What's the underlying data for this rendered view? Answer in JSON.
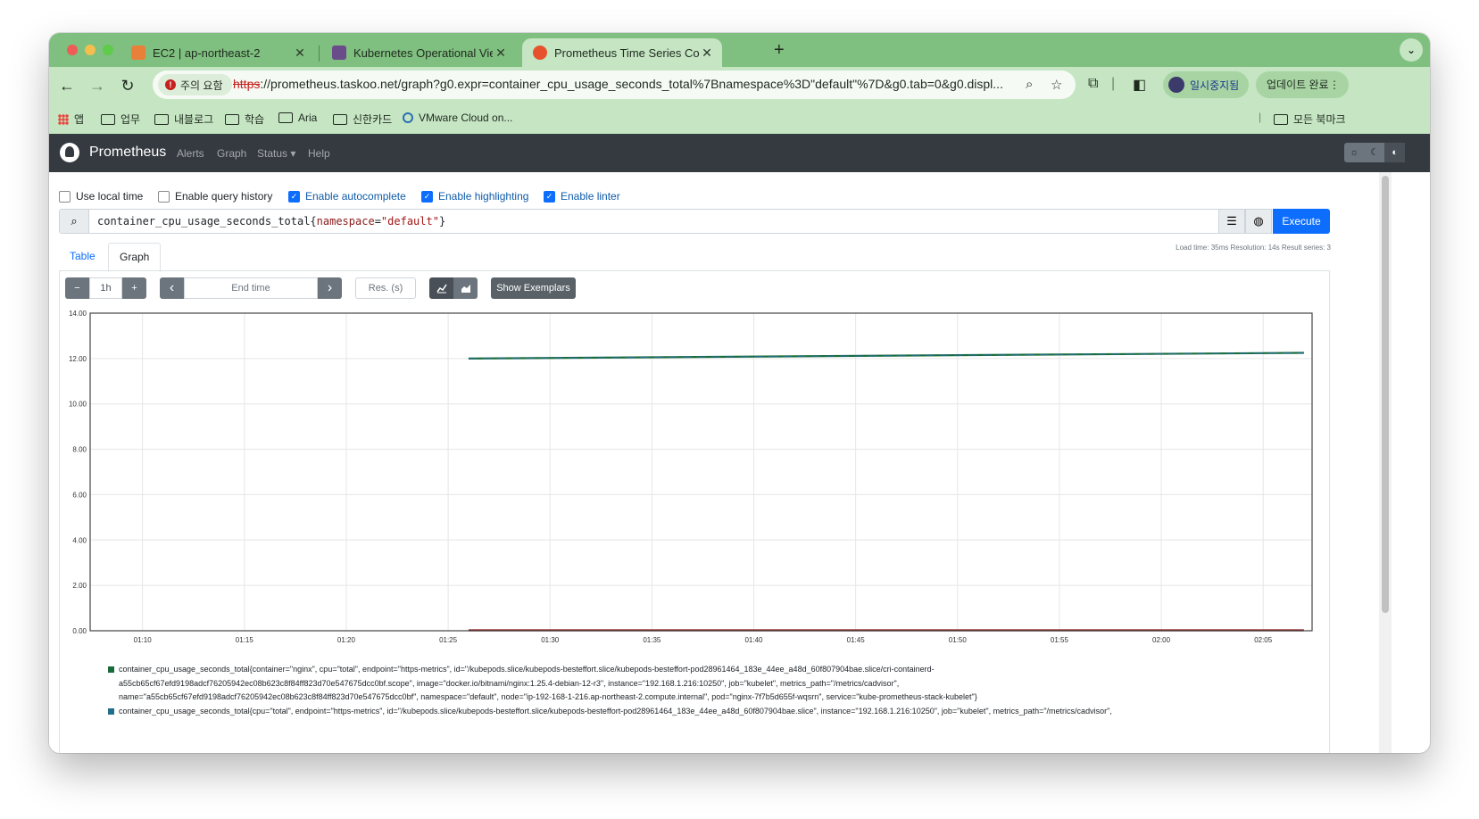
{
  "browser": {
    "tabs": [
      {
        "title": "EC2 | ap-northeast-2",
        "color": "#e8803a"
      },
      {
        "title": "Kubernetes Operational View",
        "color": "#6a4c8a"
      },
      {
        "title": "Prometheus Time Series Colle",
        "color": "#e6522c"
      }
    ],
    "security_chip": "주의 요함",
    "url_scheme": "https",
    "url_rest": "://prometheus.taskoo.net/graph?g0.expr=container_cpu_usage_seconds_total%7Bnamespace%3D\"default\"%7D&g0.tab=0&g0.displ...",
    "profile_label": "일시중지됨",
    "update_label": "업데이트 완료",
    "bookmarks": [
      "앱",
      "업무",
      "내블로그",
      "학습",
      "Aria",
      "신한카드",
      "VMware Cloud on..."
    ],
    "all_bookmarks": "모든 북마크"
  },
  "prometheus": {
    "brand": "Prometheus",
    "menu": [
      "Alerts",
      "Graph",
      "Status ▾",
      "Help"
    ],
    "options": [
      {
        "label": "Use local time",
        "checked": false
      },
      {
        "label": "Enable query history",
        "checked": false
      },
      {
        "label": "Enable autocomplete",
        "checked": true
      },
      {
        "label": "Enable highlighting",
        "checked": true
      },
      {
        "label": "Enable linter",
        "checked": true
      }
    ],
    "query": {
      "metric": "container_cpu_usage_seconds_total",
      "open": "{",
      "label_name": "namespace",
      "eq": "=",
      "label_value": "\"default\"",
      "close": "}"
    },
    "execute_label": "Execute",
    "stats": "Load time: 35ms   Resolution: 14s   Result series: 3",
    "tabs": [
      "Table",
      "Graph"
    ],
    "controls": {
      "minus": "−",
      "range": "1h",
      "plus": "+",
      "prev": "‹",
      "end_time_placeholder": "End time",
      "next": "›",
      "res_placeholder": "Res. (s)",
      "show_exemplars": "Show Exemplars"
    }
  },
  "chart_data": {
    "type": "line",
    "y_ticks": [
      "0.00",
      "2.00",
      "4.00",
      "6.00",
      "8.00",
      "10.00",
      "12.00",
      "14.00"
    ],
    "ylim": [
      0,
      14
    ],
    "x_ticks": [
      "01:10",
      "01:15",
      "01:20",
      "01:25",
      "01:30",
      "01:35",
      "01:40",
      "01:45",
      "01:50",
      "01:55",
      "02:00",
      "02:05"
    ],
    "series": [
      {
        "color": "#1b6b3a",
        "x": [
          "01:26",
          "02:07"
        ],
        "y": [
          12.0,
          12.25
        ]
      },
      {
        "color": "#1f6f8b",
        "x": [
          "01:26",
          "02:07"
        ],
        "y": [
          12.0,
          12.25
        ]
      },
      {
        "color": "#8b1a1a",
        "x": [
          "01:26",
          "02:07"
        ],
        "y": [
          0.02,
          0.02
        ]
      }
    ],
    "grid": true
  },
  "legend": [
    {
      "color": "#1b6b3a",
      "line1_pre": "container_cpu_usage_seconds_total{",
      "line1": "container=\"nginx\", cpu=\"total\", endpoint=\"https-metrics\", id=\"/kubepods.slice/kubepods-besteffort.slice/kubepods-besteffort-pod28961464_183e_44ee_a48d_60f807904bae.slice/cri-containerd-",
      "line2": "a55cb65cf67efd9198adcf76205942ec08b623c8f84ff823d70e547675dcc0bf.scope\", image=\"docker.io/bitnami/nginx:1.25.4-debian-12-r3\", instance=\"192.168.1.216:10250\", job=\"kubelet\", metrics_path=\"/metrics/cadvisor\",",
      "line3": "name=\"a55cb65cf67efd9198adcf76205942ec08b623c8f84ff823d70e547675dcc0bf\", namespace=\"default\", node=\"ip-192-168-1-216.ap-northeast-2.compute.internal\", pod=\"nginx-7f7b5d655f-wqsrn\", service=\"kube-prometheus-stack-kubelet\"}"
    },
    {
      "color": "#1f6f8b",
      "line1_pre": "container_cpu_usage_seconds_total{",
      "line1": "cpu=\"total\", endpoint=\"https-metrics\", id=\"/kubepods.slice/kubepods-besteffort.slice/kubepods-besteffort-pod28961464_183e_44ee_a48d_60f807904bae.slice\", instance=\"192.168.1.216:10250\", job=\"kubelet\", metrics_path=\"/metrics/cadvisor\","
    }
  ]
}
